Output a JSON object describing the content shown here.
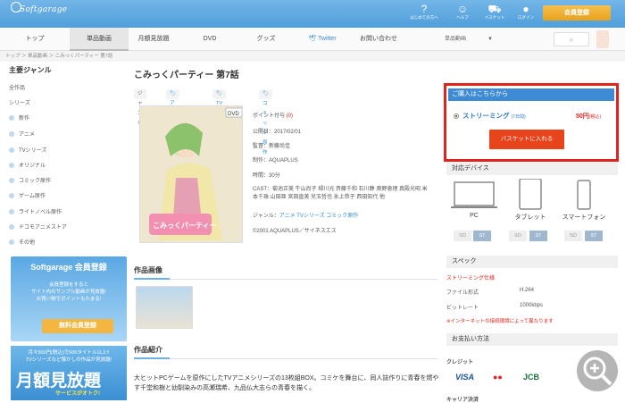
{
  "header": {
    "logo": "Softgarage",
    "icons": [
      {
        "label": "はじめての方へ",
        "icon": "question-circle-icon"
      },
      {
        "label": "ヘルプ",
        "icon": "help-icon"
      },
      {
        "label": "バスケット",
        "icon": "basket-icon"
      },
      {
        "label": "ログイン",
        "icon": "user-icon"
      }
    ],
    "register_label": "会員登録"
  },
  "nav": {
    "items": [
      "トップ",
      "単品動画",
      "月額見放題",
      "DVD",
      "グッズ",
      "Twitter",
      "お問い合わせ"
    ],
    "active_index": 1,
    "select_value": "単品動画",
    "search_icon": "search-icon"
  },
  "breadcrumb": "トップ ＞ 単品動画 ＞ こみっくパーティー 第7話",
  "sidebar": {
    "heading": "主要ジャンル",
    "items": [
      "全作品",
      "シリーズ",
      "新作",
      "アニメ",
      "TVシリーズ",
      "オリジナル",
      "コミック原作",
      "ゲーム原作",
      "ライトノベル原作",
      "ドコモアニメストア",
      "その他"
    ],
    "banner_member": {
      "title": "Softgarage 会員登録",
      "text": "会員登録をすると\nサイト内のサンプル動画が見放題!\nお買い物でポイントもたまる!",
      "button": "無料会員登録"
    },
    "banner_monthly": {
      "text": "月々500円(税込)で600タイトル以上!!\nTVシリーズなど懐かしの作品が見放題!",
      "title": "月額見放題",
      "sub": "サービスがオトク!"
    }
  },
  "product": {
    "title": "こみっくパーティー 第7話",
    "tags_label": "ジャンル",
    "tags": [
      "アニメ",
      "TVシリーズ",
      "コミック原作"
    ],
    "cover_title": "こみっくパーティー",
    "meta": [
      {
        "k": "ポイント付与",
        "v": "(0)"
      },
      {
        "k": "公開日：",
        "v": "2017/02/01"
      },
      {
        "k": "監督：",
        "v": "新藤尚佳"
      },
      {
        "k": "制作：",
        "v": "AQUAPLUS"
      },
      {
        "k": "時間：",
        "v": "30分"
      },
      {
        "k": "CAST：",
        "v": "菊池正美 牛山尚子 緑川光 斉藤千和 石川静 奥野恵理 真殿光昭 米本千珠 山田亜 宮田直美 兒玉哲也 氷上恭子 西田知代 他"
      },
      {
        "k": "ジャンル：",
        "v": "アニメ TVシリーズ コミック原作"
      },
      {
        "k": "",
        "v": "©2001 AQUAPLUS／サイネスエス"
      }
    ],
    "image_section": "作品画像",
    "intro_section": "作品紹介",
    "description": "大ヒットPCゲームを原作にしたTVアニメシリーズの13枚組BOX。コミケを舞台に、同人誌作りに青春を燃やす千堂和樹と幼馴染みの高瀬瑞希、九品仏大志らの青春を描く。"
  },
  "purchase": {
    "heading": "ご購入はこちらから",
    "option": "ストリーミング",
    "period": "(7日間)",
    "price": "50円",
    "tax": "(税込)",
    "button": "バスケットに入れる"
  },
  "devices": {
    "heading": "対応デバイス",
    "items": [
      {
        "name": "PC",
        "icon": "pc-icon"
      },
      {
        "name": "タブレット",
        "icon": "tablet-icon"
      },
      {
        "name": "スマートフォン",
        "icon": "smartphone-icon"
      }
    ],
    "sd": "SD",
    "st": "ST"
  },
  "spec": {
    "heading": "スペック",
    "type": "ストリーミング仕様",
    "rows": [
      {
        "k": "ファイル形式",
        "v": "H.264"
      },
      {
        "k": "ビットレート",
        "v": "1000kbps"
      }
    ],
    "note": "※インターネットの接続環境によって異なります"
  },
  "payment": {
    "heading": "お支払い方法",
    "credit": "クレジット",
    "cards": [
      "VISA",
      "●●",
      "JCB"
    ],
    "career": "キャリア決済"
  },
  "zoom_icon": "zoom-in-icon",
  "colors": {
    "accent": "#3d8bd5",
    "header": "#5aa8e4",
    "alert": "#e0241d",
    "cart": "#e8441c"
  }
}
